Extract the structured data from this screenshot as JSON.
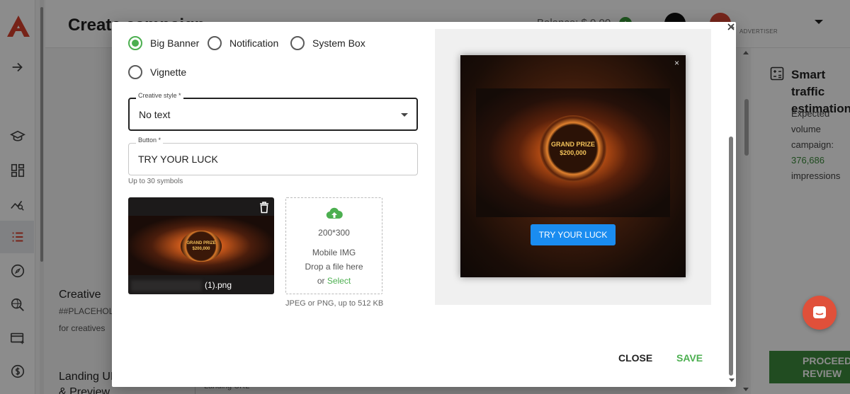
{
  "app": {
    "page_title": "Create campaign",
    "balance_label": "Balance: $ 0.00",
    "balance_badge": "+",
    "role_label": "ADVERTISER"
  },
  "form_sections": {
    "creative_label": "Creative",
    "creative_placeholder": "##PLACEHOLDER",
    "creative_sub": "for creatives",
    "landing_label": "Landing URL",
    "landing_label_2": "& Preview",
    "landing_field": "Landing URL"
  },
  "estimation": {
    "title": "Smart traffic estimation",
    "text_1": "Expected volume",
    "text_2": "campaign:",
    "value": "376,686",
    "value_suffix": " impressions"
  },
  "proceed": {
    "line1": "PROCEED",
    "line2": "REVIEW"
  },
  "modal": {
    "format_options": [
      {
        "label": "Big Banner",
        "checked": true
      },
      {
        "label": "Notification",
        "checked": false
      },
      {
        "label": "System Box",
        "checked": false
      },
      {
        "label": "Vignette",
        "checked": false
      }
    ],
    "creative_style": {
      "label": "Creative style *",
      "value": "No text"
    },
    "button_field": {
      "label": "Button *",
      "value": "TRY YOUR LUCK",
      "helper": "Up to 30 symbols"
    },
    "uploaded_image": {
      "file_name": "(1).png",
      "chip_line1": "GRAND PRIZE",
      "chip_line2": "$200,000"
    },
    "upload_box": {
      "size": "200*300",
      "type": "Mobile IMG",
      "drop_text": "Drop a file here",
      "or_text": "or",
      "select_text": "Select",
      "hint": "JPEG or PNG, up to 512 KB"
    },
    "preview": {
      "close_glyph": "×",
      "chip_line1": "GRAND PRIZE",
      "chip_line2": "$200,000",
      "cta": "TRY YOUR LUCK"
    },
    "actions": {
      "close": "CLOSE",
      "save": "SAVE"
    }
  },
  "colors": {
    "accent_green": "#4caf50",
    "cta_blue": "#1a8cf0",
    "brand_red": "#e0503a"
  }
}
